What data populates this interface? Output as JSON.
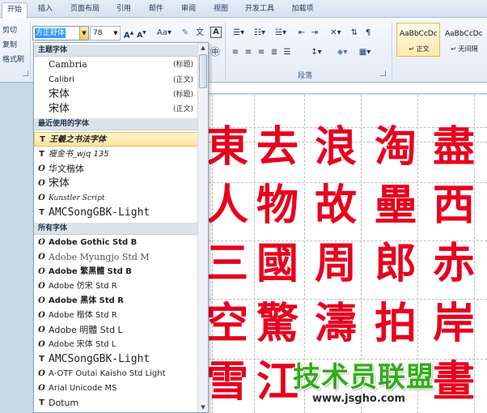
{
  "tabs": [
    "开始",
    "插入",
    "页面布局",
    "引用",
    "邮件",
    "审阅",
    "视图",
    "开发工具",
    "加载项"
  ],
  "active_tab": "开始",
  "clipboard": {
    "cut": "剪切",
    "copy": "复制",
    "format_painter": "格式刷"
  },
  "font": {
    "current_font": "方正舒体",
    "current_size": "78"
  },
  "groups": {
    "paragraph": "段落"
  },
  "styles": [
    {
      "preview": "AaBbCcDc",
      "name": "↵ 正文",
      "selected": true
    },
    {
      "preview": "AaBbCcDc",
      "name": "↵ 无间隔",
      "selected": false
    }
  ],
  "font_dropdown": {
    "theme_header": "主题字体",
    "theme_fonts": [
      {
        "name": "Cambria",
        "tag": "(标题)"
      },
      {
        "name": "Calibri",
        "tag": "(正文)"
      },
      {
        "name": "宋体",
        "tag": "(标题)"
      },
      {
        "name": "宋体",
        "tag": "(正文)"
      }
    ],
    "recent_header": "最近使用的字体",
    "recent_fonts": [
      {
        "icon": "T",
        "name": "王羲之书法字体",
        "highlighted": true
      },
      {
        "icon": "T",
        "name": "瘦金书_wjq 135"
      },
      {
        "icon": "O",
        "name": "华文楷体"
      },
      {
        "icon": "O",
        "name": "宋体"
      },
      {
        "icon": "O",
        "name": "Kunstler Script"
      },
      {
        "icon": "T",
        "name": "AMCSongGBK-Light"
      }
    ],
    "all_header": "所有字体",
    "all_fonts": [
      {
        "icon": "O",
        "name": "Adobe Gothic Std B"
      },
      {
        "icon": "O",
        "name": "Adobe Myungjo Std M"
      },
      {
        "icon": "O",
        "name": "Adobe 繁黑體 Std B"
      },
      {
        "icon": "O",
        "name": "Adobe 仿宋 Std R"
      },
      {
        "icon": "O",
        "name": "Adobe 黑体 Std R"
      },
      {
        "icon": "O",
        "name": "Adobe 楷体 Std R"
      },
      {
        "icon": "O",
        "name": "Adobe 明體 Std L"
      },
      {
        "icon": "O",
        "name": "Adobe 宋体 Std L"
      },
      {
        "icon": "T",
        "name": "AMCSongGBK-Light"
      },
      {
        "icon": "O",
        "name": "A-OTF Outai Kaisho Std Light"
      },
      {
        "icon": "O",
        "name": "Arial Unicode MS"
      },
      {
        "icon": "T",
        "name": "Dotum"
      }
    ]
  },
  "document": {
    "characters": [
      [
        "東",
        "去",
        "浪",
        "淘",
        "盡"
      ],
      [
        "人",
        "物",
        "故",
        "壘",
        "西"
      ],
      [
        "三",
        "國",
        "周",
        "郎",
        "赤"
      ],
      [
        "空",
        "驚",
        "濤",
        "拍",
        "岸"
      ],
      [
        "雪",
        "江",
        "",
        "",
        "畫"
      ]
    ],
    "char_color": "#e8001e"
  },
  "watermark": {
    "title": "技术员联盟",
    "url": "www.jsgho.com",
    "color": "#2fae17"
  }
}
